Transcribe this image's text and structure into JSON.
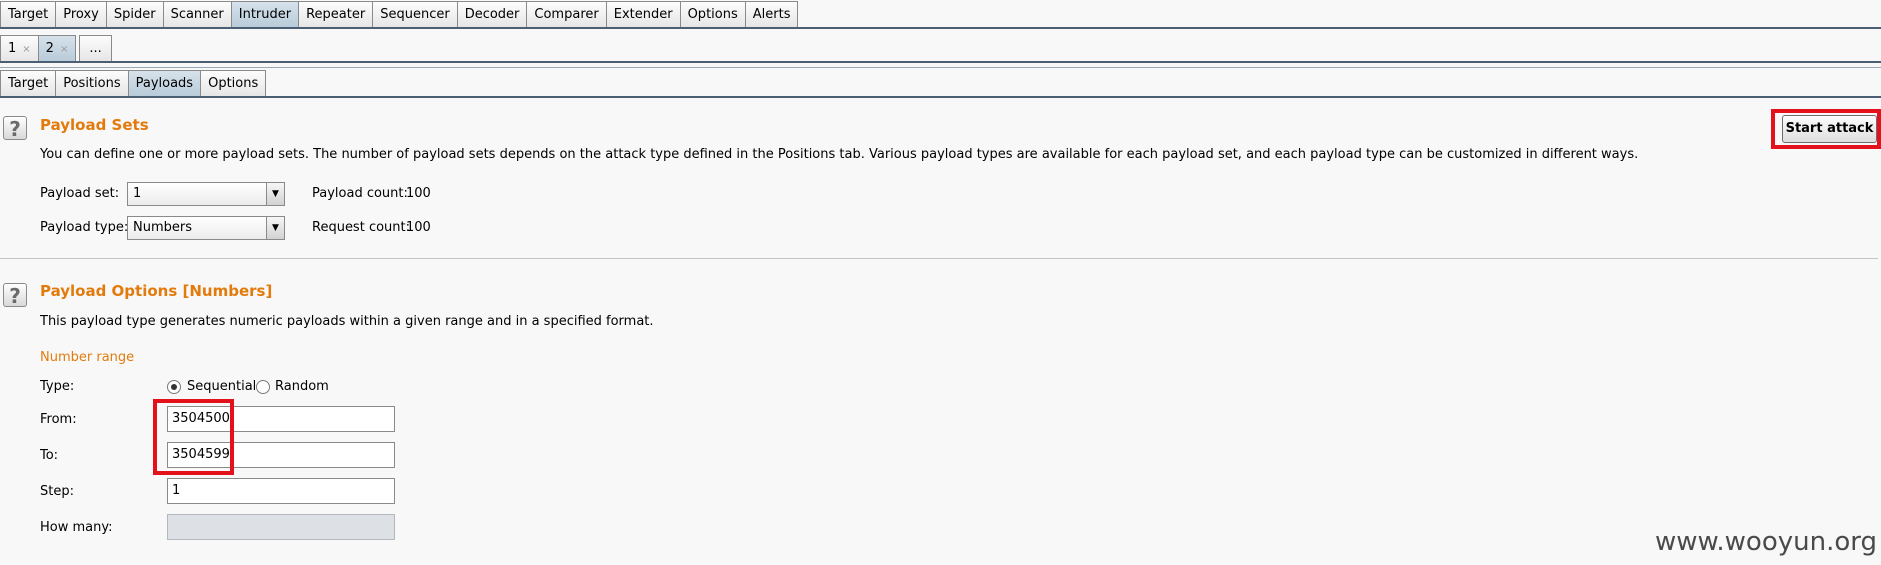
{
  "main_tabs": [
    "Target",
    "Proxy",
    "Spider",
    "Scanner",
    "Intruder",
    "Repeater",
    "Sequencer",
    "Decoder",
    "Comparer",
    "Extender",
    "Options",
    "Alerts"
  ],
  "main_tab_selected": "Intruder",
  "attack_tabs": [
    {
      "label": "1",
      "close": "×"
    },
    {
      "label": "2",
      "close": "×"
    },
    {
      "label": "...",
      "close": ""
    }
  ],
  "sub_tabs": [
    "Target",
    "Positions",
    "Payloads",
    "Options"
  ],
  "sub_tab_selected": "Payloads",
  "payload_sets": {
    "help_icon": "?",
    "title": "Payload Sets",
    "description": "You can define one or more payload sets. The number of payload sets depends on the attack type defined in the Positions tab. Various payload types are available for each payload set, and each payload type can be customized in different ways.",
    "set_label": "Payload set:",
    "set_value": "1",
    "type_label": "Payload type:",
    "type_value": "Numbers",
    "payload_count_label": "Payload count:",
    "payload_count": "100",
    "request_count_label": "Request count:",
    "request_count": "100",
    "start_attack": "Start attack"
  },
  "payload_options": {
    "help_icon": "?",
    "title": "Payload Options [Numbers]",
    "description": "This payload type generates numeric payloads within a given range and in a specified format.",
    "number_range": "Number range",
    "type_label": "Type:",
    "sequential": "Sequential",
    "random": "Random",
    "selected_type": "Sequential",
    "from_label": "From:",
    "from_value": "3504500",
    "to_label": "To:",
    "to_value": "3504599",
    "step_label": "Step:",
    "step_value": "1",
    "how_many_label": "How many:",
    "how_many_value": ""
  },
  "watermark": "www.wooyun.org",
  "colors": {
    "heading": "#e37b0c",
    "highlight": "#e3111b",
    "selected_tab": "#bccddb"
  },
  "icons": {
    "help": "help-icon",
    "dropdown": "chevron-down-icon",
    "close": "close-icon"
  }
}
